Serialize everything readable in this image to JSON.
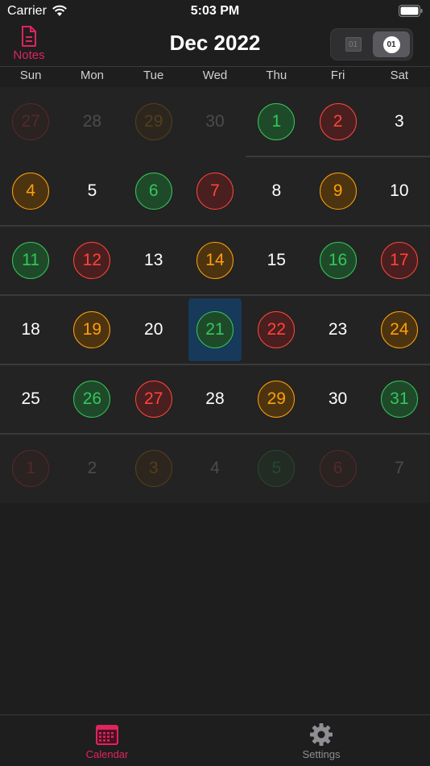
{
  "status_bar": {
    "carrier": "Carrier",
    "time": "5:03 PM"
  },
  "header": {
    "notes_label": "Notes",
    "title": "Dec 2022",
    "toggle_left": "01",
    "toggle_right": "01"
  },
  "weekdays": [
    "Sun",
    "Mon",
    "Tue",
    "Wed",
    "Thu",
    "Fri",
    "Sat"
  ],
  "weeks": [
    [
      {
        "day": "27",
        "color": "red",
        "faded": true
      },
      {
        "day": "28",
        "color": "none",
        "faded": true
      },
      {
        "day": "29",
        "color": "orange",
        "faded": true
      },
      {
        "day": "30",
        "color": "none",
        "faded": true
      },
      {
        "day": "1",
        "color": "green",
        "faded": false
      },
      {
        "day": "2",
        "color": "red",
        "faded": false
      },
      {
        "day": "3",
        "color": "none",
        "faded": false
      }
    ],
    [
      {
        "day": "4",
        "color": "orange",
        "faded": false
      },
      {
        "day": "5",
        "color": "none",
        "faded": false
      },
      {
        "day": "6",
        "color": "green",
        "faded": false
      },
      {
        "day": "7",
        "color": "red",
        "faded": false
      },
      {
        "day": "8",
        "color": "none",
        "faded": false
      },
      {
        "day": "9",
        "color": "orange",
        "faded": false
      },
      {
        "day": "10",
        "color": "none",
        "faded": false
      }
    ],
    [
      {
        "day": "11",
        "color": "green",
        "faded": false
      },
      {
        "day": "12",
        "color": "red",
        "faded": false
      },
      {
        "day": "13",
        "color": "none",
        "faded": false
      },
      {
        "day": "14",
        "color": "orange",
        "faded": false
      },
      {
        "day": "15",
        "color": "none",
        "faded": false
      },
      {
        "day": "16",
        "color": "green",
        "faded": false
      },
      {
        "day": "17",
        "color": "red",
        "faded": false
      }
    ],
    [
      {
        "day": "18",
        "color": "none",
        "faded": false
      },
      {
        "day": "19",
        "color": "orange",
        "faded": false
      },
      {
        "day": "20",
        "color": "none",
        "faded": false
      },
      {
        "day": "21",
        "color": "green",
        "faded": false,
        "today": true
      },
      {
        "day": "22",
        "color": "red",
        "faded": false
      },
      {
        "day": "23",
        "color": "none",
        "faded": false
      },
      {
        "day": "24",
        "color": "orange",
        "faded": false
      }
    ],
    [
      {
        "day": "25",
        "color": "none",
        "faded": false
      },
      {
        "day": "26",
        "color": "green",
        "faded": false
      },
      {
        "day": "27",
        "color": "red",
        "faded": false
      },
      {
        "day": "28",
        "color": "none",
        "faded": false
      },
      {
        "day": "29",
        "color": "orange",
        "faded": false
      },
      {
        "day": "30",
        "color": "none",
        "faded": false
      },
      {
        "day": "31",
        "color": "green",
        "faded": false
      }
    ],
    [
      {
        "day": "1",
        "color": "red",
        "faded": true
      },
      {
        "day": "2",
        "color": "none",
        "faded": true
      },
      {
        "day": "3",
        "color": "orange",
        "faded": true
      },
      {
        "day": "4",
        "color": "none",
        "faded": true
      },
      {
        "day": "5",
        "color": "green",
        "faded": true
      },
      {
        "day": "6",
        "color": "red",
        "faded": true
      },
      {
        "day": "7",
        "color": "none",
        "faded": true
      }
    ]
  ],
  "tabs": [
    {
      "label": "Calendar",
      "icon": "calendar-icon",
      "active": true
    },
    {
      "label": "Settings",
      "icon": "gear-icon",
      "active": false
    }
  ],
  "colors": {
    "accent": "#e0245e",
    "green": "#34c759",
    "red": "#ff453a",
    "orange": "#ff9f0a",
    "today_highlight": "#17395a"
  }
}
